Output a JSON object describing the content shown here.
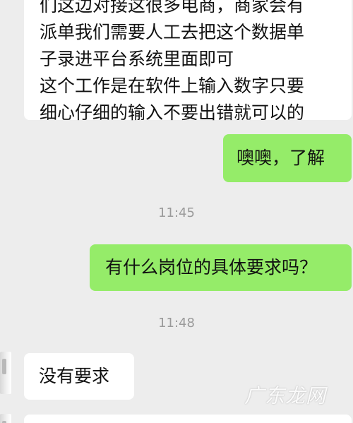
{
  "chat": {
    "messages": [
      {
        "from": "contact",
        "lines": [
          "们这边对接这很多电商，商家会有",
          "派单我们需要人工去把这个数据单",
          "子录进平台系统里面即可",
          "这个工作是在软件上输入数字只要",
          "细心仔细的输入不要出错就可以的"
        ]
      },
      {
        "from": "me",
        "text": "噢噢，了解"
      },
      {
        "type": "time",
        "text": "11:45"
      },
      {
        "from": "me",
        "text": "有什么岗位的具体要求吗？"
      },
      {
        "type": "time",
        "text": "11:48"
      },
      {
        "from": "contact",
        "text": "没有要求"
      }
    ]
  },
  "watermark": "广东龙网",
  "colors": {
    "background": "#ededed",
    "incoming_bubble": "#ffffff",
    "outgoing_bubble": "#95ec69",
    "timestamp": "#9a9a9a"
  }
}
